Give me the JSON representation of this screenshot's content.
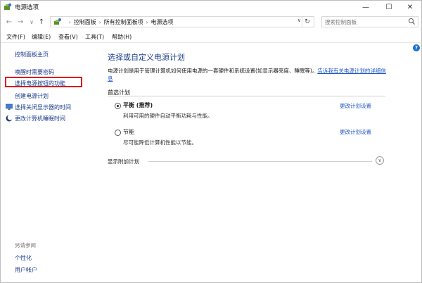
{
  "window": {
    "title": "电源选项"
  },
  "address": {
    "crumbs": [
      "控制面板",
      "所有控制面板项",
      "电源选项"
    ]
  },
  "search": {
    "placeholder": "搜索控制面板"
  },
  "menu": {
    "items": [
      "文件(F)",
      "编辑(E)",
      "查看(V)",
      "工具(T)",
      "帮助(H)"
    ]
  },
  "sidebar": {
    "home": "控制面板主页",
    "items": [
      "唤醒时需要密码",
      "选择电源按钮的功能",
      "创建电源计划",
      "选择关闭显示器的时间",
      "更改计算机睡眠时间"
    ],
    "see_also_label": "另请参阅",
    "see_also": [
      "个性化",
      "用户帐户"
    ]
  },
  "main": {
    "title": "选择或自定义电源计划",
    "description": "电源计划是用于管理计算机如何使用电源的一套硬件和系统设置(如显示器亮度、睡眠等)。",
    "description_link": "告诉我有关电源计划的详细信息",
    "preferred_label": "首选计划",
    "plans": [
      {
        "name": "平衡 (推荐)",
        "description": "利用可用的硬件自动平衡功耗与性能。",
        "link": "更改计划设置",
        "selected": true
      },
      {
        "name": "节能",
        "description": "尽可能降低计算机性能以节能。",
        "link": "更改计划设置",
        "selected": false
      }
    ],
    "extra_plans_label": "显示附加计划"
  },
  "colors": {
    "link": "#1f56c8",
    "title": "#1e3d8f",
    "highlight": "#e0191d"
  }
}
